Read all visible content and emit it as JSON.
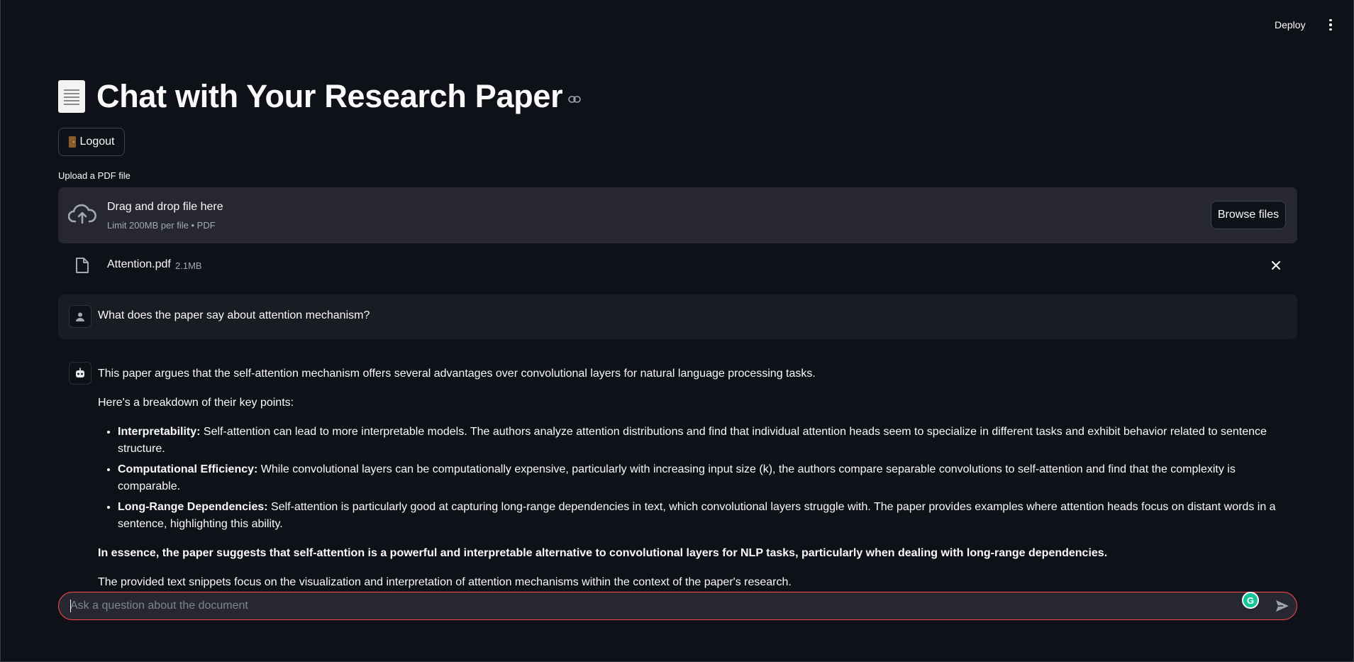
{
  "header": {
    "deploy_label": "Deploy",
    "menu_icon": "kebab-menu-icon"
  },
  "page": {
    "title": "Chat with Your Research Paper",
    "title_icon": "document-icon",
    "anchor_icon": "link-icon"
  },
  "logout": {
    "label": "Logout",
    "icon": "door-icon"
  },
  "uploader": {
    "label": "Upload a PDF file",
    "drop_title": "Drag and drop file here",
    "drop_sub": "Limit 200MB per file • PDF",
    "browse_label": "Browse files",
    "file": {
      "name": "Attention.pdf",
      "size": "2.1MB"
    }
  },
  "chat": {
    "user_message": "What does the paper say about attention mechanism?",
    "assistant": {
      "intro": "This paper argues that the self-attention mechanism offers several advantages over convolutional layers for natural language processing tasks.",
      "breakdown": "Here's a breakdown of their key points:",
      "points": [
        {
          "title": "Interpretability:",
          "text": " Self-attention can lead to more interpretable models. The authors analyze attention distributions and find that individual attention heads seem to specialize in different tasks and exhibit behavior related to sentence structure."
        },
        {
          "title": "Computational Efficiency:",
          "text": " While convolutional layers can be computationally expensive, particularly with increasing input size (k), the authors compare separable convolutions to self-attention and find that the complexity is comparable."
        },
        {
          "title": "Long-Range Dependencies:",
          "text": " Self-attention is particularly good at capturing long-range dependencies in text, which convolutional layers struggle with. The paper provides examples where attention heads focus on distant words in a sentence, highlighting this ability."
        }
      ],
      "essence": "In essence, the paper suggests that self-attention is a powerful and interpretable alternative to convolutional layers for NLP tasks, particularly when dealing with long-range dependencies.",
      "closing": "The provided text snippets focus on the visualization and interpretation of attention mechanisms within the context of the paper's research."
    }
  },
  "input": {
    "placeholder": "Ask a question about the document",
    "value": "",
    "grammarly_letter": "G"
  },
  "colors": {
    "background": "#0e1117",
    "panel": "#262730",
    "accent": "#ff4b4b",
    "grammarly": "#15c39a"
  }
}
